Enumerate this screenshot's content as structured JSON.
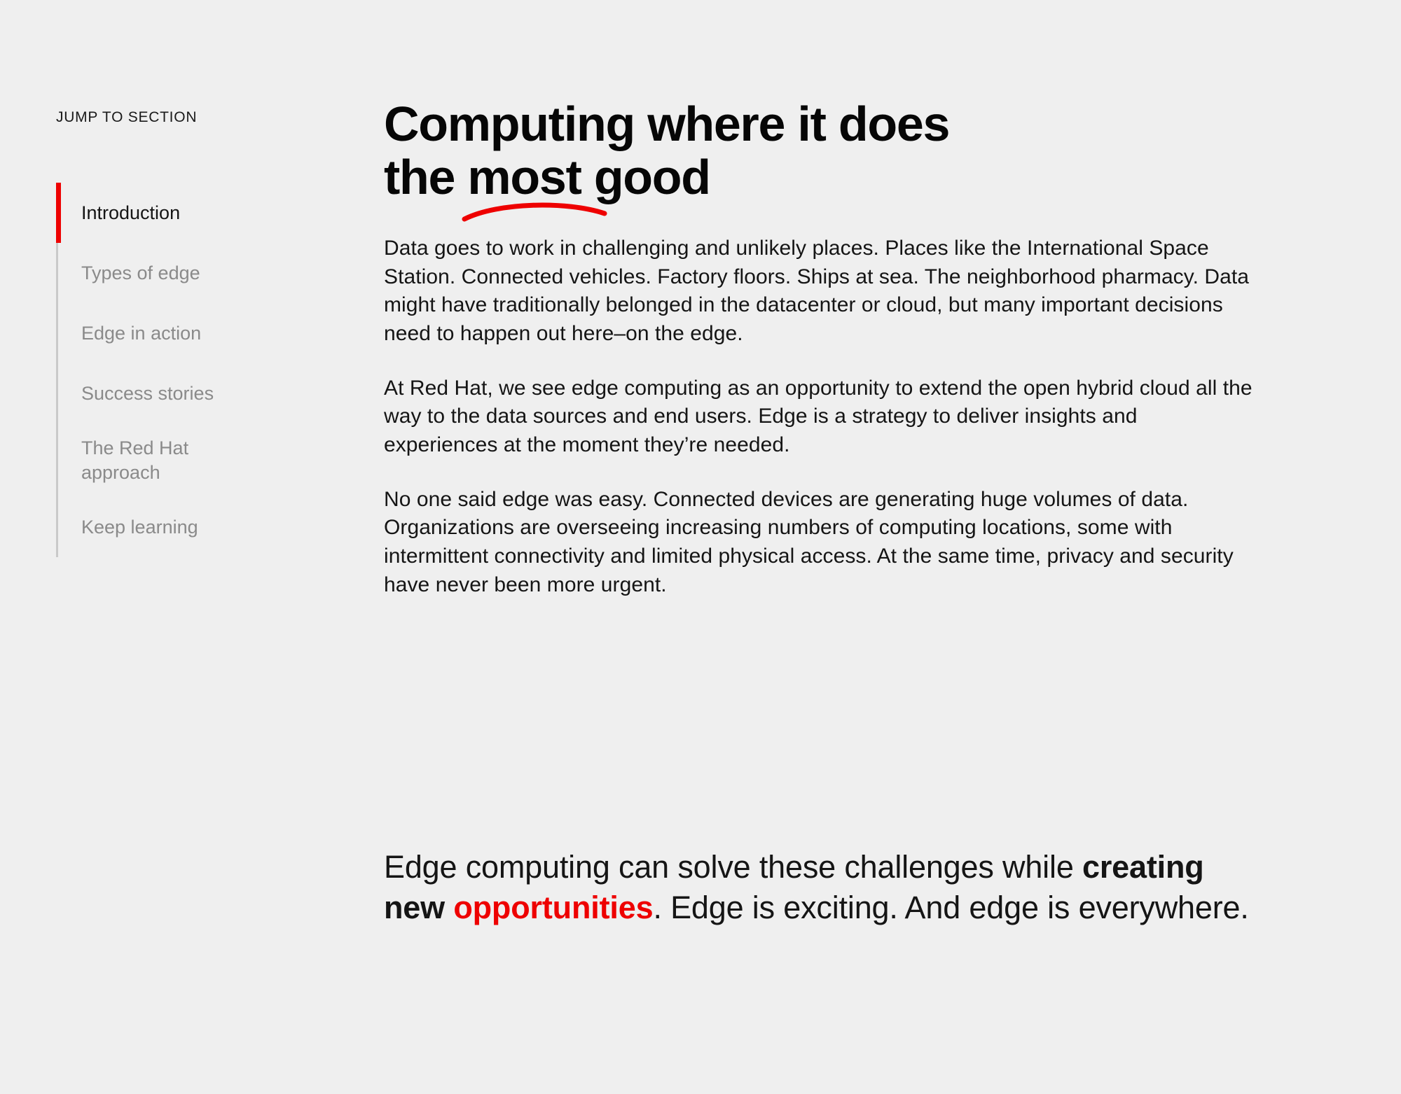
{
  "colors": {
    "background": "#efefef",
    "accent_red": "#ee0000",
    "text": "#151515",
    "muted_text": "#8a8a8a",
    "rule": "#c9c9c9"
  },
  "sidebar": {
    "label": "JUMP TO SECTION",
    "items": [
      {
        "label": "Introduction",
        "active": true
      },
      {
        "label": "Types of edge",
        "active": false
      },
      {
        "label": "Edge in action",
        "active": false
      },
      {
        "label": "Success stories",
        "active": false
      },
      {
        "label": "The Red Hat approach",
        "line1": "The Red Hat",
        "line2": "approach",
        "active": false
      },
      {
        "label": "Keep learning",
        "active": false
      }
    ]
  },
  "main": {
    "headline": {
      "line1": "Computing where it does",
      "line2_before": "the ",
      "line2_underlined": "most",
      "line2_after": " good",
      "underline_icon": "red-swoosh-underline"
    },
    "paragraphs": [
      "Data goes to work in challenging and unlikely places. Places like the International Space Station. Connected vehicles. Factory floors. Ships at sea. The neighborhood pharmacy. Data might have traditionally belonged in the datacenter or cloud, but many important decisions need to happen out here–on the edge.",
      "At Red Hat, we see edge computing as an opportunity to extend the open hybrid cloud all the way to the data sources and end users. Edge is a strategy to deliver insights and experiences at the moment they’re needed.",
      "No one said edge was easy. Connected devices are generating huge volumes of data. Organizations are overseeing increasing numbers of computing locations, some with intermittent connectivity and limited physical access. At the same time, privacy and security have never been more urgent."
    ],
    "pull_quote": {
      "part1": "Edge computing can solve these challenges while ",
      "bold": "creating new ",
      "accent": "opportunities",
      "part2": ". Edge is exciting. And edge is everywhere."
    }
  }
}
